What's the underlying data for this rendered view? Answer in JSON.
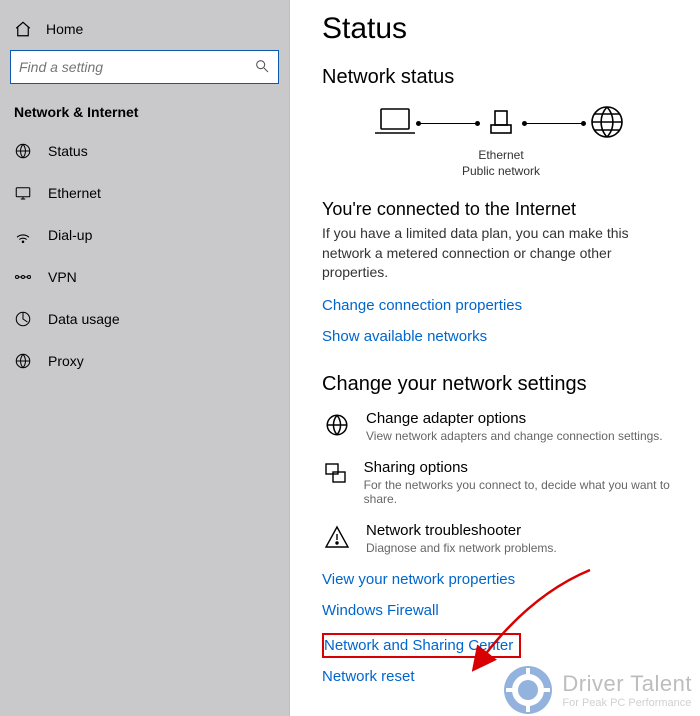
{
  "sidebar": {
    "home_label": "Home",
    "search_placeholder": "Find a setting",
    "section_title": "Network & Internet",
    "items": [
      {
        "label": "Status"
      },
      {
        "label": "Ethernet"
      },
      {
        "label": "Dial-up"
      },
      {
        "label": "VPN"
      },
      {
        "label": "Data usage"
      },
      {
        "label": "Proxy"
      }
    ]
  },
  "main": {
    "title": "Status",
    "network_status_heading": "Network status",
    "diagram": {
      "device_label": "Ethernet",
      "network_type": "Public network"
    },
    "connected_heading": "You're connected to the Internet",
    "connected_desc": "If you have a limited data plan, you can make this network a metered connection or change other properties.",
    "link_change_props": "Change connection properties",
    "link_show_networks": "Show available networks",
    "change_settings_heading": "Change your network settings",
    "options": [
      {
        "title": "Change adapter options",
        "desc": "View network adapters and change connection settings."
      },
      {
        "title": "Sharing options",
        "desc": "For the networks you connect to, decide what you want to share."
      },
      {
        "title": "Network troubleshooter",
        "desc": "Diagnose and fix network problems."
      }
    ],
    "link_view_props": "View your network properties",
    "link_firewall": "Windows Firewall",
    "link_sharing_center": "Network and Sharing Center",
    "link_reset": "Network reset"
  },
  "watermark": {
    "line1": "Driver Talent",
    "line2": "For Peak PC Performance"
  }
}
